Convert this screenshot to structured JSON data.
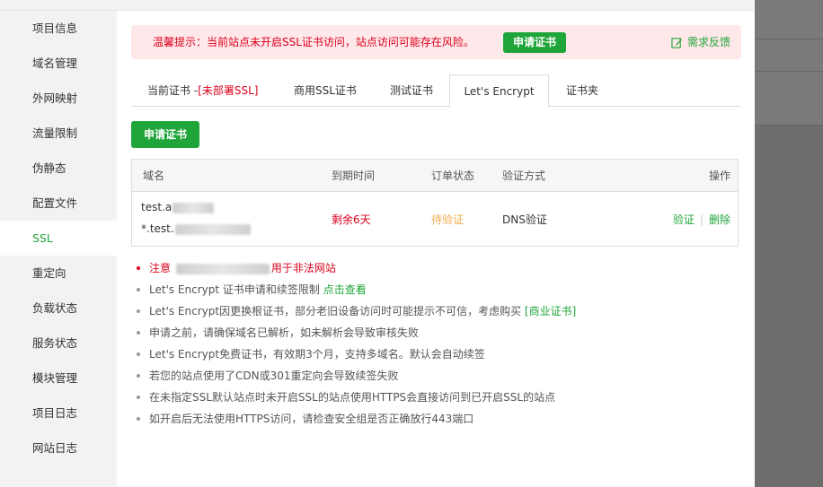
{
  "sidebar": {
    "items": [
      {
        "label": "项目信息"
      },
      {
        "label": "域名管理"
      },
      {
        "label": "外网映射"
      },
      {
        "label": "流量限制"
      },
      {
        "label": "伪静态"
      },
      {
        "label": "配置文件"
      },
      {
        "label": "SSL"
      },
      {
        "label": "重定向"
      },
      {
        "label": "负载状态"
      },
      {
        "label": "服务状态"
      },
      {
        "label": "模块管理"
      },
      {
        "label": "项目日志"
      },
      {
        "label": "网站日志"
      }
    ],
    "active_index": 6
  },
  "alert": {
    "text": "温馨提示：当前站点未开启SSL证书访问，站点访问可能存在风险。",
    "button": "申请证书",
    "feedback": "需求反馈"
  },
  "tabs": {
    "current_prefix": "当前证书 -",
    "current_status": "[未部署SSL]",
    "commercial": "商用SSL证书",
    "test": "测试证书",
    "letsencrypt": "Let's Encrypt",
    "folder": "证书夹",
    "active": "letsencrypt"
  },
  "apply_button": "申请证书",
  "table": {
    "headers": {
      "domain": "域名",
      "expire": "到期时间",
      "status": "订单状态",
      "verify": "验证方式",
      "ops": "操作"
    },
    "row": {
      "domain_1": "test.a",
      "domain_2": "*.test.",
      "expire": "剩余6天",
      "status": "待验证",
      "verify": "DNS验证",
      "op_verify": "验证",
      "op_delete": "删除"
    }
  },
  "notes": {
    "warn_prefix": "注意",
    "warn_suffix": "用于非法网站",
    "n1_text": "Let's Encrypt 证书申请和续签限制 ",
    "n1_link": "点击查看",
    "n2_text": "Let's Encrypt因更换根证书，部分老旧设备访问时可能提示不可信，考虑购买 ",
    "n2_link": "[商业证书]",
    "n3": "申请之前，请确保域名已解析，如未解析会导致审核失败",
    "n4": "Let's Encrypt免费证书，有效期3个月，支持多域名。默认会自动续签",
    "n5": "若您的站点使用了CDN或301重定向会导致续签失败",
    "n6": "在未指定SSL默认站点时未开启SSL的站点使用HTTPS会直接访问到已开启SSL的站点",
    "n7": "如开启后无法使用HTTPS访问，请检查安全组是否正确放行443端口"
  },
  "colors": {
    "accent": "#20a53a",
    "danger": "#d9001b",
    "pending": "#f0ad4e"
  },
  "icons": {
    "feedback": "edit-icon"
  }
}
